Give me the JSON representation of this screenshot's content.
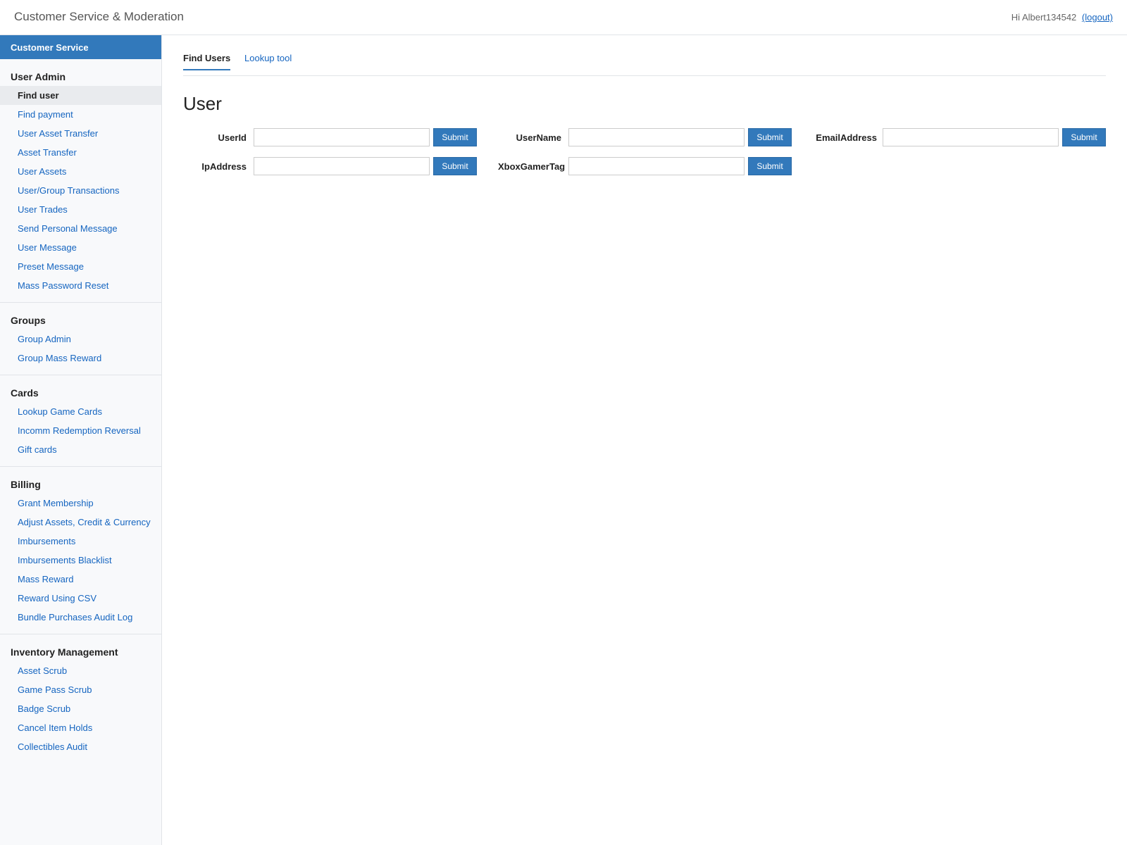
{
  "header": {
    "title": "Customer Service & Moderation",
    "greeting": "Hi Albert134542",
    "logout": "(logout)"
  },
  "sidebar": {
    "heading": "Customer Service",
    "sections": [
      {
        "title": "User Admin",
        "items": [
          "Find user",
          "Find payment",
          "User Asset Transfer",
          "Asset Transfer",
          "User Assets",
          "User/Group Transactions",
          "User Trades",
          "Send Personal Message",
          "User Message",
          "Preset Message",
          "Mass Password Reset"
        ]
      },
      {
        "title": "Groups",
        "items": [
          "Group Admin",
          "Group Mass Reward"
        ]
      },
      {
        "title": "Cards",
        "items": [
          "Lookup Game Cards",
          "Incomm Redemption Reversal",
          "Gift cards"
        ]
      },
      {
        "title": "Billing",
        "items": [
          "Grant Membership",
          "Adjust Assets, Credit & Currency",
          "Imbursements",
          "Imbursements Blacklist",
          "Mass Reward",
          "Reward Using CSV",
          "Bundle Purchases Audit Log"
        ]
      },
      {
        "title": "Inventory Management",
        "items": [
          "Asset Scrub",
          "Game Pass Scrub",
          "Badge Scrub",
          "Cancel Item Holds",
          "Collectibles Audit"
        ]
      }
    ],
    "active_item": "Find user"
  },
  "tabs": [
    {
      "label": "Find Users",
      "active": true
    },
    {
      "label": "Lookup tool",
      "active": false
    }
  ],
  "main": {
    "title": "User",
    "fields": {
      "userid": {
        "label": "UserId",
        "value": "",
        "button": "Submit"
      },
      "username": {
        "label": "UserName",
        "value": "",
        "button": "Submit"
      },
      "email": {
        "label": "EmailAddress",
        "value": "",
        "button": "Submit"
      },
      "ip": {
        "label": "IpAddress",
        "value": "",
        "button": "Submit"
      },
      "xbox": {
        "label": "XboxGamerTag",
        "value": "",
        "button": "Submit"
      }
    }
  },
  "colors": {
    "accent": "#3279bb",
    "link": "#1565c0",
    "sidebar_bg": "#f8f9fb"
  }
}
